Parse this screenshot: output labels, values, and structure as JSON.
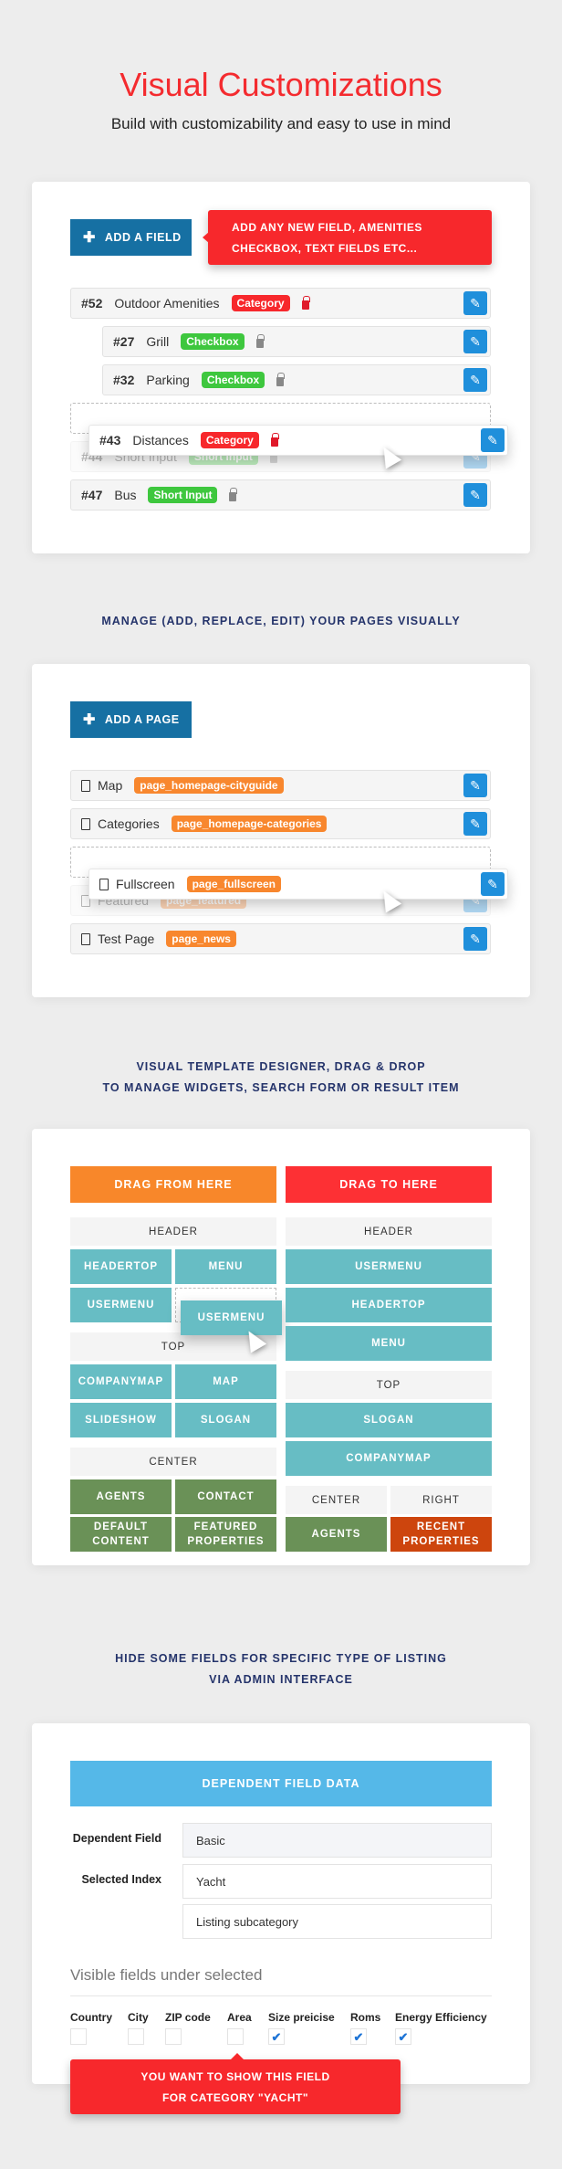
{
  "hero": {
    "title": "Visual Customizations",
    "subtitle": "Build with customizability and easy to use in mind"
  },
  "colors": {
    "accent_red": "#f7282c",
    "primary_blue": "#1670a3",
    "edit_blue": "#1f8fdb",
    "green_badge": "#3ec73e",
    "orange_badge": "#f8872e",
    "teal_tile": "#67bdc4",
    "green_tile": "#6a9157",
    "rust_tile": "#cd450d",
    "heading_navy": "#25346b"
  },
  "fields": {
    "add_label": "ADD A FIELD",
    "tooltip": [
      "ADD ANY NEW FIELD, AMENITIES",
      "CHECKBOX, TEXT FIELDS ETC..."
    ],
    "rows": [
      {
        "id": "#52",
        "name": "Outdoor Amenities",
        "type": "Category"
      },
      {
        "id": "#27",
        "name": "Grill",
        "type": "Checkbox"
      },
      {
        "id": "#32",
        "name": "Parking",
        "type": "Checkbox"
      },
      {
        "id": "#44",
        "name": "Short Input",
        "type": "Short Input"
      },
      {
        "id": "#47",
        "name": "Bus",
        "type": "Short Input"
      }
    ],
    "dragged": {
      "id": "#43",
      "name": "Distances",
      "type": "Category"
    }
  },
  "pages": {
    "heading": "MANAGE (ADD, REPLACE, EDIT) YOUR PAGES VISUALLY",
    "add_label": "ADD A PAGE",
    "rows": [
      {
        "name": "Map",
        "tag": "page_homepage-cityguide"
      },
      {
        "name": "Categories",
        "tag": "page_homepage-categories"
      },
      {
        "name": "Featured",
        "tag": "page_featured"
      },
      {
        "name": "Test Page",
        "tag": "page_news"
      }
    ],
    "dragged": {
      "name": "Fullscreen",
      "tag": "page_fullscreen"
    }
  },
  "designer": {
    "heading": [
      "VISUAL TEMPLATE DESIGNER, DRAG & DROP",
      "TO MANAGE WIDGETS, SEARCH FORM OR RESULT ITEM"
    ],
    "from": "DRAG FROM HERE",
    "to": "DRAG TO HERE",
    "left": {
      "header": "HEADER",
      "headertop": "HEADERTOP",
      "menu": "MENU",
      "usermenu": "USERMENU",
      "top": "TOP",
      "companymap": "COMPANYMAP",
      "map": "MAP",
      "slideshow": "SLIDESHOW",
      "slogan": "SLOGAN",
      "center": "CENTER",
      "agents": "AGENTS",
      "contact": "CONTACT",
      "default_content": "DEFAULT CONTENT",
      "featured_properties": "FEATURED PROPERTIES"
    },
    "dragged": "USERMENU",
    "right": {
      "header": "HEADER",
      "usermenu": "USERMENU",
      "headertop": "HEADERTOP",
      "menu": "MENU",
      "top": "TOP",
      "slogan": "SLOGAN",
      "companymap": "COMPANYMAP",
      "center": "CENTER",
      "right": "RIGHT",
      "agents": "AGENTS",
      "recent_properties": "RECENT PROPERTIES"
    }
  },
  "dependent": {
    "heading": [
      "HIDE SOME FIELDS FOR SPECIFIC TYPE OF LISTING",
      "VIA ADMIN INTERFACE"
    ],
    "panel_title": "DEPENDENT FIELD DATA",
    "dependent_field_label": "Dependent Field",
    "dependent_field_value": "Basic",
    "selected_index_label": "Selected Index",
    "selected_index_value": "Yacht",
    "subcategory_value": "Listing subcategory",
    "visible_title": "Visible fields under selected",
    "checkboxes": [
      {
        "label": "Country",
        "checked": false
      },
      {
        "label": "City",
        "checked": false
      },
      {
        "label": "ZIP code",
        "checked": false
      },
      {
        "label": "Area",
        "checked": false
      },
      {
        "label": "Size preicise",
        "checked": true
      },
      {
        "label": "Roms",
        "checked": true
      },
      {
        "label": "Energy Efficiency",
        "checked": true
      }
    ],
    "tooltip": [
      "YOU WANT TO SHOW THIS FIELD",
      "FOR CATEGORY  \"YACHT\""
    ]
  }
}
